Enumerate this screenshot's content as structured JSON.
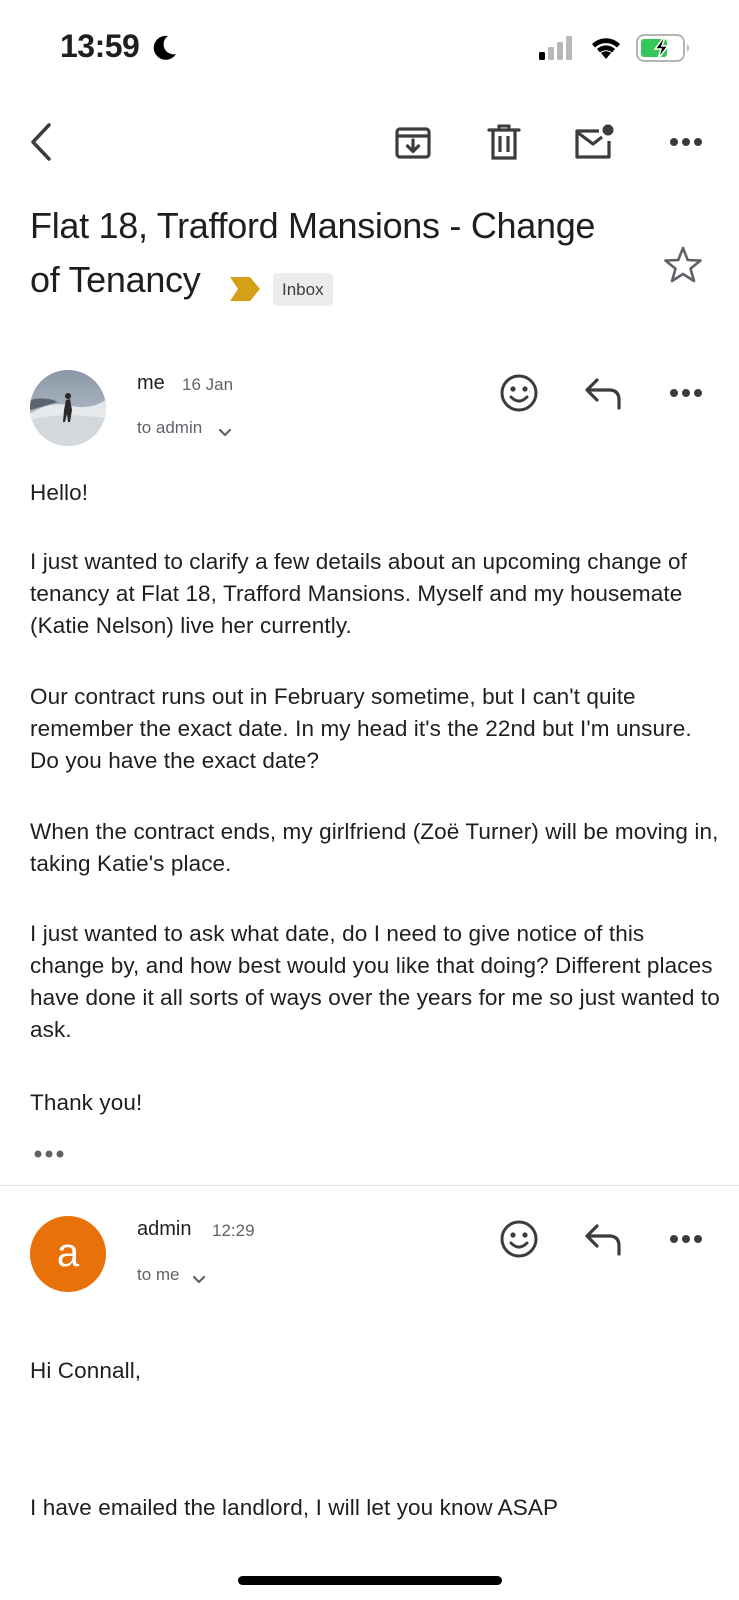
{
  "status_bar": {
    "time": "13:59",
    "icons": [
      "moon-icon",
      "cellular-signal-icon",
      "wifi-icon",
      "battery-charging-icon"
    ],
    "battery_color": "#34c759"
  },
  "toolbar": {
    "icons": [
      "back-icon",
      "archive-icon",
      "trash-icon",
      "mark-unread-icon",
      "more-icon"
    ]
  },
  "subject": {
    "line1": "Flat 18, Trafford Mansions - Change",
    "line2": "of Tenancy",
    "label": "Inbox",
    "importance_color": "#d4a017"
  },
  "messages": [
    {
      "sender": "me",
      "date": "16 Jan",
      "recipients": "to admin",
      "body": [
        "Hello!",
        "I just wanted to clarify a few details about an upcoming change of tenancy at Flat 18, Trafford Mansions. Myself and my housemate (Katie Nelson) live her currently.",
        "Our contract runs out in February sometime, but I can't quite remember the exact date. In my head it's the 22nd but I'm unsure. Do you have the exact date?",
        "When the contract ends, my girlfriend (Zoë Turner) will be moving in, taking Katie's place.",
        "I just wanted to ask what date, do I need to give notice of this change by, and how best would you like that doing? Different places have done it all sorts of ways over the years for me so just wanted to ask.",
        "Thank you!"
      ]
    },
    {
      "sender": "admin",
      "avatar_letter": "a",
      "avatar_color": "#e8710a",
      "date": "12:29",
      "recipients": "to me",
      "body": [
        "Hi Connall,",
        "I have emailed the landlord, I will let you know ASAP"
      ]
    }
  ]
}
